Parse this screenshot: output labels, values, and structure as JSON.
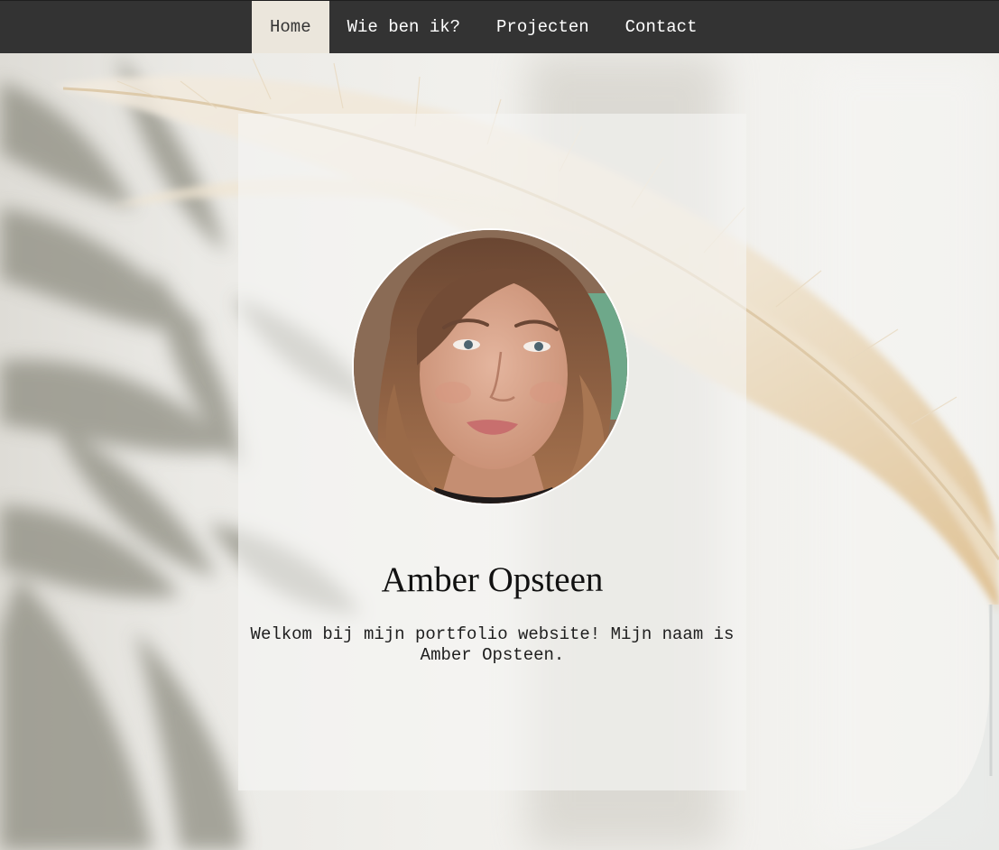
{
  "nav": {
    "items": [
      {
        "label": "Home",
        "active": true
      },
      {
        "label": "Wie ben ik?",
        "active": false
      },
      {
        "label": "Projecten",
        "active": false
      },
      {
        "label": "Contact",
        "active": false
      }
    ]
  },
  "profile": {
    "name": "Amber Opsteen",
    "intro": "Welkom bij mijn portfolio website! Mijn naam is Amber Opsteen."
  },
  "colors": {
    "navbar": "#333333",
    "nav_active_bg": "#ebe6dc",
    "card_bg": "#f5f5f3"
  },
  "icons": {
    "background": "pampas-grass-photo",
    "avatar": "profile-photo"
  }
}
